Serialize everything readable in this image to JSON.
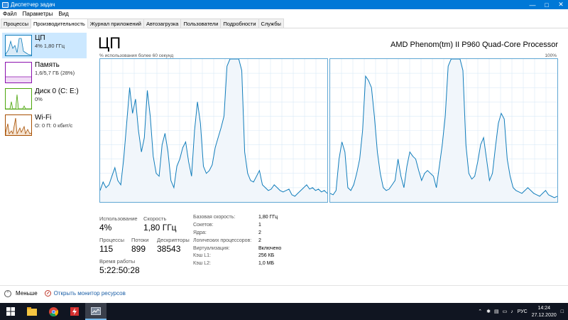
{
  "window": {
    "title": "Диспетчер задач"
  },
  "menu": {
    "items": [
      "Файл",
      "Параметры",
      "Вид"
    ]
  },
  "tabs": [
    "Процессы",
    "Производительность",
    "Журнал приложений",
    "Автозагрузка",
    "Пользователи",
    "Подробности",
    "Службы"
  ],
  "sidebar": {
    "items": [
      {
        "name": "ЦП",
        "sub": "4% 1,80 ГГц",
        "color": "#117dbb"
      },
      {
        "name": "Память",
        "sub": "1,6/5,7 ГБ (28%)",
        "color": "#8b12ae"
      },
      {
        "name": "Диск 0 (C: E:)",
        "sub": "0%",
        "color": "#4da60c"
      },
      {
        "name": "Wi-Fi",
        "sub": "О: 0 П: 0 кбит/с",
        "color": "#a74f01"
      }
    ]
  },
  "cpu": {
    "heading": "ЦП",
    "processor_name": "AMD Phenom(tm) II P960 Quad-Core Processor",
    "graph_caption": "% использования более 60 секунд",
    "graph_max": "100%",
    "series": [
      [
        8,
        14,
        10,
        12,
        18,
        24,
        15,
        12,
        30,
        55,
        80,
        62,
        72,
        50,
        35,
        45,
        78,
        60,
        32,
        20,
        18,
        40,
        48,
        35,
        15,
        10,
        25,
        30,
        38,
        42,
        28,
        18,
        50,
        70,
        55,
        25,
        20,
        22,
        26,
        38,
        45,
        52,
        60,
        95,
        100,
        100,
        100,
        100,
        92,
        35,
        20,
        15,
        14,
        18,
        22,
        12,
        10,
        8,
        9,
        12,
        10,
        8,
        7,
        8,
        9,
        5,
        4,
        6,
        8,
        10,
        12,
        9,
        10,
        8,
        9,
        7,
        8,
        6
      ],
      [
        6,
        5,
        8,
        30,
        42,
        35,
        10,
        8,
        12,
        20,
        30,
        50,
        88,
        85,
        80,
        60,
        35,
        20,
        10,
        8,
        9,
        12,
        15,
        30,
        18,
        10,
        25,
        35,
        32,
        30,
        22,
        15,
        20,
        22,
        20,
        18,
        10,
        25,
        40,
        60,
        95,
        100,
        100,
        100,
        100,
        92,
        40,
        20,
        16,
        18,
        28,
        40,
        45,
        30,
        15,
        20,
        38,
        55,
        62,
        58,
        30,
        18,
        10,
        8,
        7,
        6,
        8,
        10,
        8,
        6,
        5,
        4,
        6,
        8,
        5,
        4,
        3,
        4
      ]
    ],
    "stats": {
      "utilization_label": "Использование",
      "utilization_value": "4%",
      "speed_label": "Скорость",
      "speed_value": "1,80 ГГц",
      "processes_label": "Процессы",
      "processes_value": "115",
      "threads_label": "Потоки",
      "threads_value": "899",
      "handles_label": "Дескрипторы",
      "handles_value": "38543",
      "uptime_label": "Время работы",
      "uptime_value": "5:22:50:28"
    },
    "specs": [
      {
        "label": "Базовая скорость:",
        "value": "1,80 ГГц"
      },
      {
        "label": "Сокетов:",
        "value": "1"
      },
      {
        "label": "Ядра:",
        "value": "2"
      },
      {
        "label": "Логических процессоров:",
        "value": "2"
      },
      {
        "label": "Виртуализация:",
        "value": "Включено"
      },
      {
        "label": "Кэш L1:",
        "value": "256 КБ"
      },
      {
        "label": "Кэш L2:",
        "value": "1,0 МБ"
      }
    ]
  },
  "footer": {
    "fewer_label": "Меньше",
    "resmon_label": "Открыть монитор ресурсов"
  },
  "taskbar": {
    "lang": "РУС",
    "time": "14:24",
    "date": "27.12.2020"
  }
}
